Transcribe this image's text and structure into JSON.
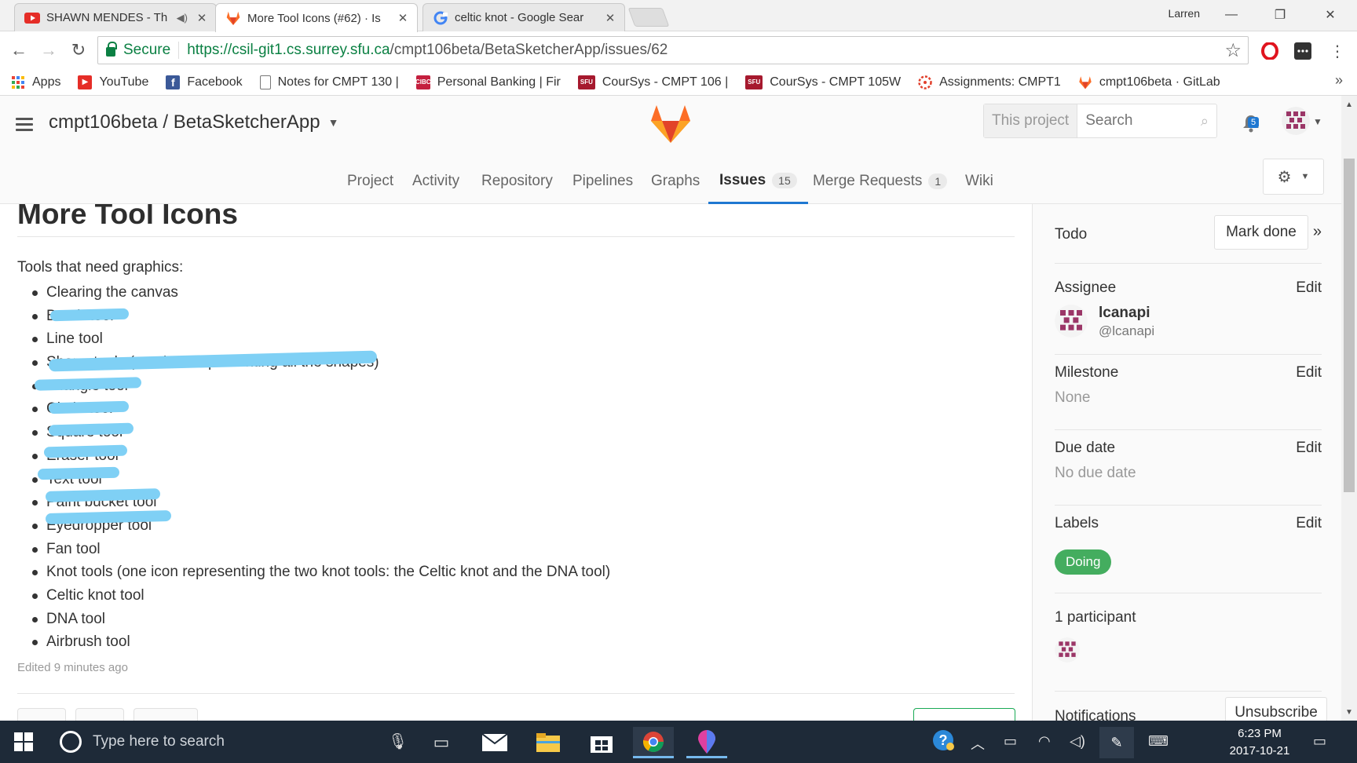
{
  "browser": {
    "tabs": [
      {
        "title": "SHAWN MENDES - Th",
        "icon": "youtube-icon",
        "audio": true
      },
      {
        "title": "More Tool Icons (#62) · Is",
        "icon": "gitlab-icon",
        "audio": false
      },
      {
        "title": "celtic knot - Google Sear",
        "icon": "google-icon",
        "audio": false
      }
    ],
    "profile_name": "Larren",
    "secure_label": "Secure",
    "url_scheme_host": "https://csil-git1.cs.surrey.sfu.ca",
    "url_path": "/cmpt106beta/BetaSketcherApp/issues/62",
    "bookmarks": [
      {
        "label": "Apps",
        "icon": "apps-grid-icon"
      },
      {
        "label": "YouTube",
        "icon": "youtube-icon"
      },
      {
        "label": "Facebook",
        "icon": "facebook-icon"
      },
      {
        "label": "Notes for CMPT 130 |",
        "icon": "page-icon"
      },
      {
        "label": "Personal Banking | Fir",
        "icon": "cibc-icon"
      },
      {
        "label": "CourSys - CMPT 106 |",
        "icon": "sfu-icon"
      },
      {
        "label": "CourSys - CMPT 105W",
        "icon": "sfu-icon"
      },
      {
        "label": "Assignments: CMPT1",
        "icon": "canvas-icon"
      },
      {
        "label": "cmpt106beta · GitLab",
        "icon": "gitlab-icon"
      }
    ],
    "bookmarks_more": "»"
  },
  "gitlab": {
    "breadcrumb": "cmpt106beta / BetaSketcherApp",
    "search_scope": "This project",
    "search_placeholder": "Search",
    "todo_count": "5",
    "nav": [
      {
        "label": "Project"
      },
      {
        "label": "Activity"
      },
      {
        "label": "Repository"
      },
      {
        "label": "Pipelines"
      },
      {
        "label": "Graphs"
      },
      {
        "label": "Issues",
        "count": "15",
        "active": true
      },
      {
        "label": "Merge Requests",
        "count": "1"
      },
      {
        "label": "Wiki"
      }
    ]
  },
  "issue": {
    "title": "More Tool Icons",
    "intro": "Tools that need graphics:",
    "items": [
      "Clearing the canvas",
      "Brush tool",
      "Line tool",
      "Shape tools (one icon representing all the shapes)",
      "Triangle tool",
      "Circle tool",
      "Square tool",
      "Eraser tool",
      "Text tool",
      "Paint bucket tool",
      "Eyedropper tool",
      "Fan tool",
      "Knot tools (one icon representing the two knot tools: the Celtic knot and the DNA tool)",
      "Celtic knot tool",
      "DNA tool",
      "Airbrush tool"
    ],
    "edited": "Edited 9 minutes ago"
  },
  "sidebar": {
    "todo_label": "Todo",
    "mark_done": "Mark done",
    "collapse": "»",
    "assignee_label": "Assignee",
    "edit": "Edit",
    "assignee_name": "lcanapi",
    "assignee_user": "@lcanapi",
    "milestone_label": "Milestone",
    "milestone_value": "None",
    "due_label": "Due date",
    "due_value": "No due date",
    "labels_label": "Labels",
    "label_doing": "Doing",
    "label_color": "#44ad5f",
    "participants": "1 participant",
    "notifications_label": "Notifications",
    "unsubscribe": "Unsubscribe"
  },
  "taskbar": {
    "search_placeholder": "Type here to search",
    "time": "6:23 PM",
    "date": "2017-10-21"
  }
}
